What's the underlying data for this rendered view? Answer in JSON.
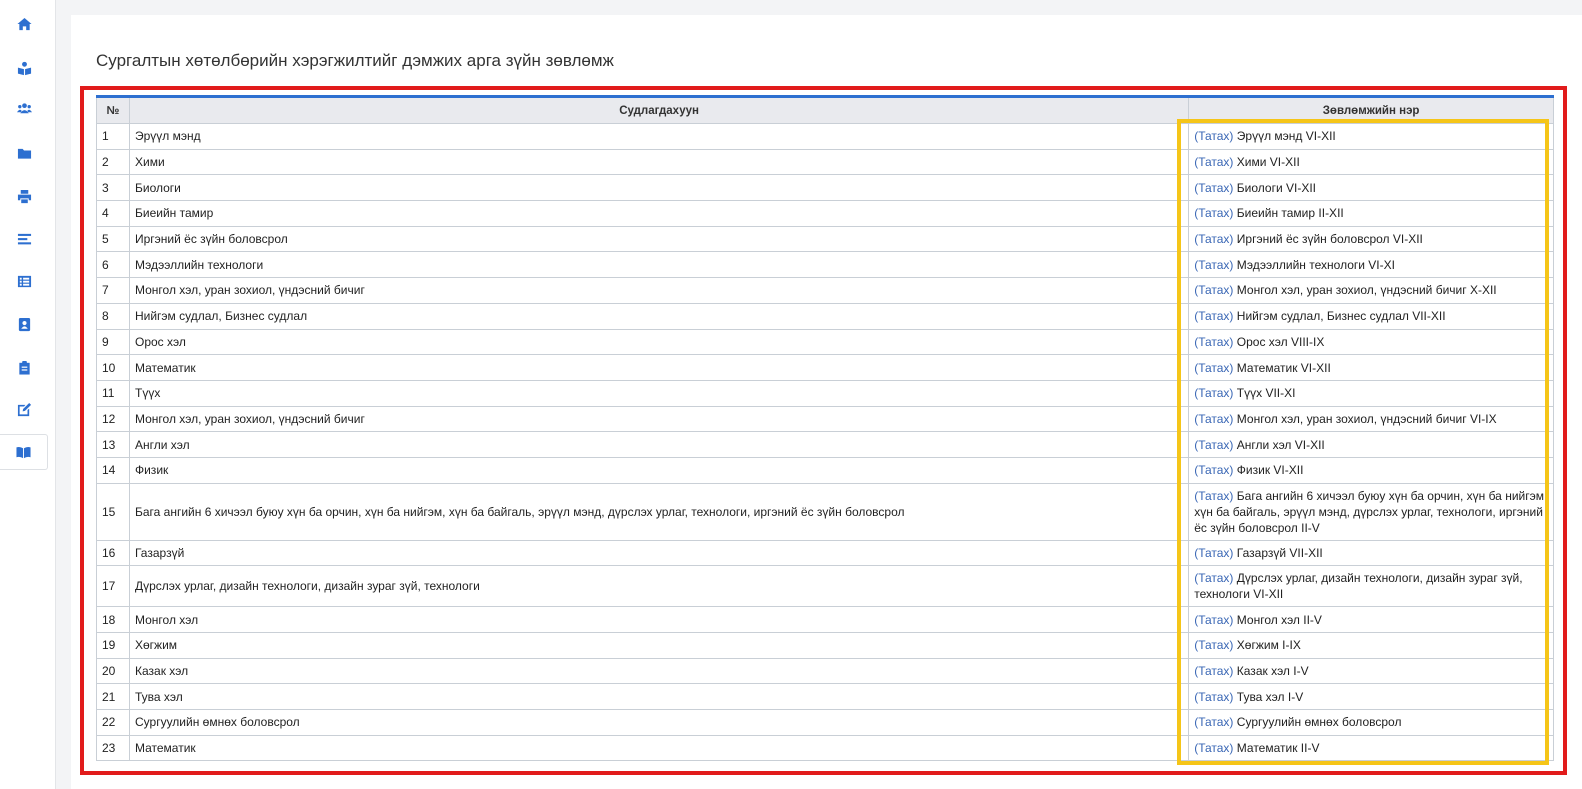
{
  "page_title": "Сургалтын хөтөлбөрийн хэрэгжилтийг дэмжих арга зүйн зөвлөмж",
  "sidebar": {
    "items": [
      {
        "icon": "home-icon"
      },
      {
        "icon": "book-reader-icon"
      },
      {
        "icon": "users-icon"
      },
      {
        "icon": "folder-icon"
      },
      {
        "icon": "print-icon"
      },
      {
        "icon": "align-icon"
      },
      {
        "icon": "list-icon"
      },
      {
        "icon": "address-card-icon"
      },
      {
        "icon": "clipboard-icon"
      },
      {
        "icon": "edit-icon"
      },
      {
        "icon": "open-book-icon"
      }
    ],
    "accent": "#2d6fd0"
  },
  "table": {
    "headers": [
      "№",
      "Судлагдахуун",
      "Зөвлөмжийн нэр"
    ],
    "link_label": "(Татах)",
    "rows": [
      {
        "no": "1",
        "subject": "Эрүүл мэнд",
        "title": "Эрүүл мэнд VI-XII"
      },
      {
        "no": "2",
        "subject": "Хими",
        "title": "Хими VI-XII"
      },
      {
        "no": "3",
        "subject": "Биологи",
        "title": "Биологи VI-XII"
      },
      {
        "no": "4",
        "subject": "Биеийн тамир",
        "title": "Биеийн тамир II-XII"
      },
      {
        "no": "5",
        "subject": "Иргэний ёс зүйн боловсрол",
        "title": "Иргэний ёс зүйн боловсрол VI-XII"
      },
      {
        "no": "6",
        "subject": "Мэдээллийн технологи",
        "title": "Мэдээллийн технологи VI-XI"
      },
      {
        "no": "7",
        "subject": "Монгол хэл, уран зохиол, үндэсний бичиг",
        "title": "Монгол хэл, уран зохиол, үндэсний бичиг X-XII"
      },
      {
        "no": "8",
        "subject": "Нийгэм судлал, Бизнес судлал",
        "title": "Нийгэм судлал, Бизнес судлал VII-XII"
      },
      {
        "no": "9",
        "subject": "Орос хэл",
        "title": "Орос хэл VIII-IX"
      },
      {
        "no": "10",
        "subject": "Математик",
        "title": "Математик VI-XII"
      },
      {
        "no": "11",
        "subject": "Түүх",
        "title": "Түүх VII-XI"
      },
      {
        "no": "12",
        "subject": "Монгол хэл, уран зохиол, үндэсний бичиг",
        "title": "Монгол хэл, уран зохиол, үндэсний бичиг VI-IX"
      },
      {
        "no": "13",
        "subject": "Англи хэл",
        "title": "Англи хэл VI-XII"
      },
      {
        "no": "14",
        "subject": "Физик",
        "title": "Физик VI-XII"
      },
      {
        "no": "15",
        "subject": "Бага ангийн 6 хичээл буюу хүн ба орчин, хүн ба нийгэм, хүн ба байгаль, эрүүл мэнд, дүрслэх урлаг, технологи, иргэний ёс зүйн боловсрол",
        "title": "Бага ангийн 6 хичээл буюу хүн ба орчин, хүн ба нийгэм, хүн ба байгаль, эрүүл мэнд, дүрслэх урлаг, технологи, иргэний ёс зүйн боловсрол II-V"
      },
      {
        "no": "16",
        "subject": "Газарзүй",
        "title": "Газарзүй VII-XII"
      },
      {
        "no": "17",
        "subject": "Дүрслэх урлаг, дизайн технологи, дизайн зураг зүй, технологи",
        "title": "Дүрслэх урлаг, дизайн технологи, дизайн зураг зүй, технологи VI-XII"
      },
      {
        "no": "18",
        "subject": "Монгол хэл",
        "title": "Монгол хэл II-V"
      },
      {
        "no": "19",
        "subject": "Хөгжим",
        "title": "Хөгжим I-IX"
      },
      {
        "no": "20",
        "subject": "Казак хэл",
        "title": "Казак хэл I-V"
      },
      {
        "no": "21",
        "subject": "Тува хэл",
        "title": "Тува хэл I-V"
      },
      {
        "no": "22",
        "subject": "Сургуулийн өмнөх боловсрол",
        "title": "Сургуулийн өмнөх боловсрол"
      },
      {
        "no": "23",
        "subject": "Математик",
        "title": "Математик II-V"
      }
    ]
  },
  "colors": {
    "highlight_red": "#e11b1b",
    "highlight_yellow": "#f5c518",
    "link": "#3a67b5"
  }
}
